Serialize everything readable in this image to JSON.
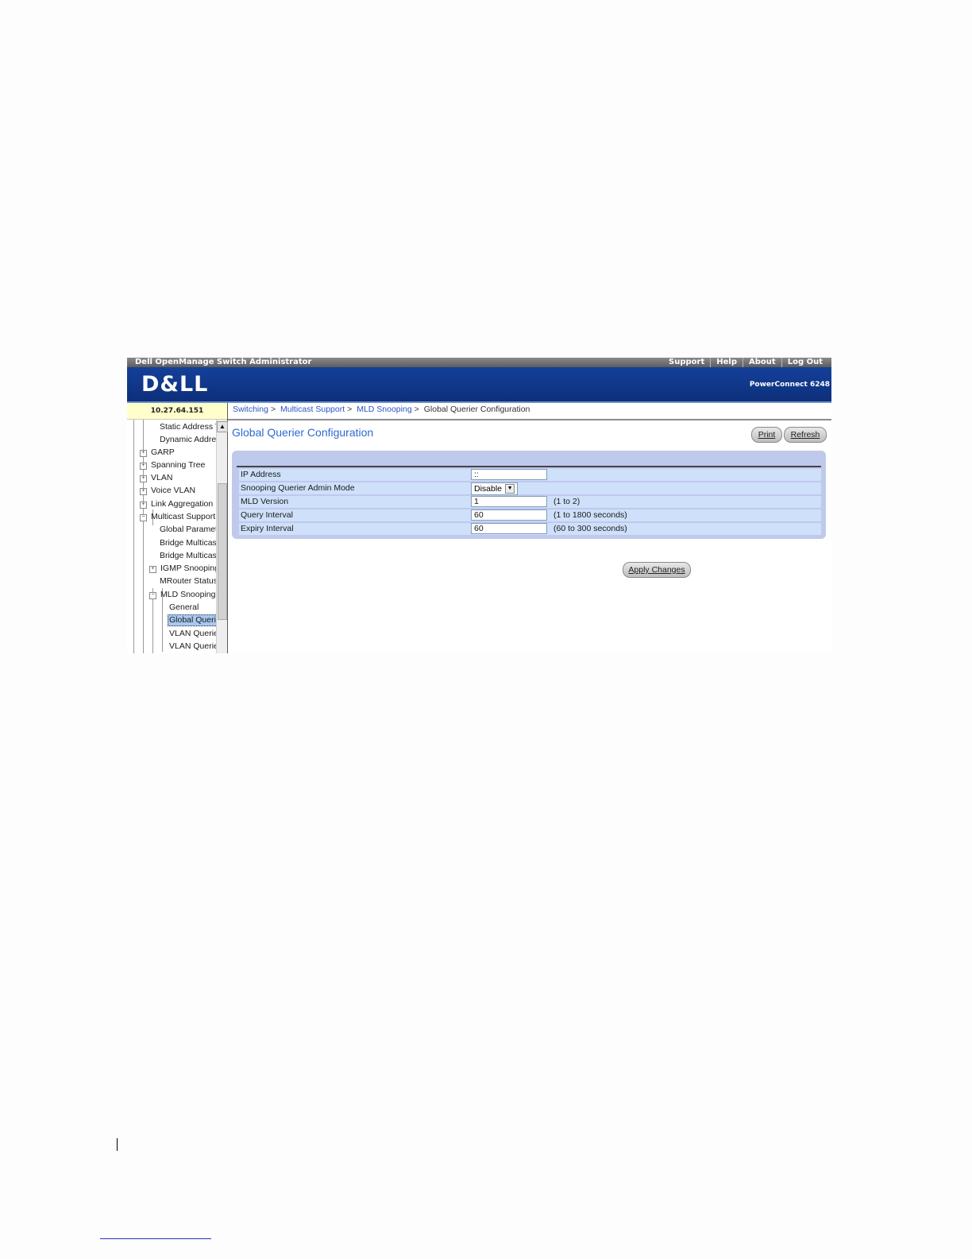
{
  "topbar": {
    "app_title": "Dell OpenManage Switch Administrator",
    "links": [
      "Support",
      "Help",
      "About",
      "Log Out"
    ]
  },
  "banner": {
    "logo": "D&LL",
    "model": "PowerConnect 6248"
  },
  "sidebar": {
    "ip_address": "10.27.64.151",
    "tree": [
      {
        "label": "Static Address T",
        "expander": ""
      },
      {
        "label": "Dynamic Addres",
        "expander": ""
      },
      {
        "label": "GARP",
        "expander": "+"
      },
      {
        "label": "Spanning Tree",
        "expander": "+"
      },
      {
        "label": "VLAN",
        "expander": "+"
      },
      {
        "label": "Voice VLAN",
        "expander": "+"
      },
      {
        "label": "Link Aggregation",
        "expander": "+"
      },
      {
        "label": "Multicast Support",
        "expander": "−"
      },
      {
        "label": "Global Paramet",
        "expander": ""
      },
      {
        "label": "Bridge Multicast",
        "expander": ""
      },
      {
        "label": "Bridge Multicast",
        "expander": ""
      },
      {
        "label": "IGMP Snooping",
        "expander": "+"
      },
      {
        "label": "MRouter Status",
        "expander": ""
      },
      {
        "label": "MLD Snooping",
        "expander": "−"
      },
      {
        "label": "General",
        "expander": ""
      },
      {
        "label": "Global Querie",
        "expander": "",
        "selected": true
      },
      {
        "label": "VLAN Querier",
        "expander": ""
      },
      {
        "label": "VLAN Querier",
        "expander": ""
      }
    ],
    "scroll_up_glyph": "▲"
  },
  "breadcrumb": {
    "items": [
      "Switching",
      "Multicast Support",
      "MLD Snooping"
    ],
    "current": "Global Querier Configuration",
    "separator": ">"
  },
  "page": {
    "title": "Global Querier Configuration",
    "print_label": "Print",
    "refresh_label": "Refresh",
    "apply_label": "Apply Changes"
  },
  "form": {
    "rows": [
      {
        "label": "IP Address",
        "value": "::",
        "range": ""
      },
      {
        "label": "Snooping Querier Admin Mode",
        "value": "Disable",
        "range": ""
      },
      {
        "label": "MLD Version",
        "value": "1",
        "range": "(1 to 2)"
      },
      {
        "label": "Query Interval",
        "value": "60",
        "range": "(1 to 1800 seconds)"
      },
      {
        "label": "Expiry Interval",
        "value": "60",
        "range": "(60 to 300 seconds)"
      }
    ]
  },
  "colors": {
    "banner": "#14409a",
    "link": "#2c55c4",
    "title": "#2d6ad2",
    "panel": "#bfc9ec",
    "row": "#cfe0fa",
    "ip_box": "#ffffcc"
  }
}
